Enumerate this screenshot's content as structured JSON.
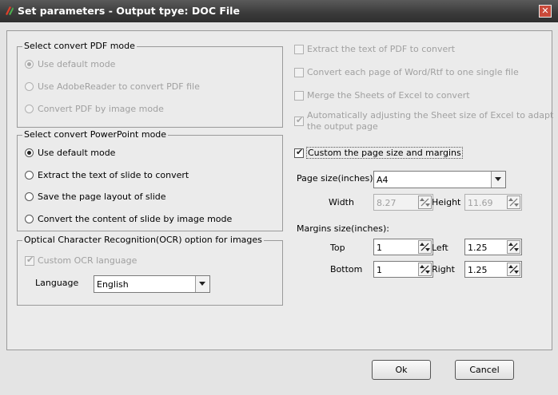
{
  "window": {
    "title": "Set parameters - Output tpye: DOC File",
    "close_icon": "close-icon"
  },
  "pdf_mode": {
    "title": "Select convert PDF mode",
    "options": [
      "Use default mode",
      "Use AdobeReader to convert PDF file",
      "Convert PDF by image mode"
    ]
  },
  "ppt_mode": {
    "title": "Select convert PowerPoint mode",
    "options": [
      "Use default mode",
      "Extract the text of slide to convert",
      "Save the page layout of slide",
      "Convert the content of slide by image mode"
    ]
  },
  "ocr": {
    "title": "Optical Character Recognition(OCR) option for images",
    "custom_label": "Custom OCR language",
    "language_label": "Language",
    "language_value": "English"
  },
  "right": {
    "extract_text": "Extract the text of PDF to convert",
    "convert_each_page": "Convert each page of Word/Rtf to one single file",
    "merge_sheets": "Merge the Sheets of Excel to convert",
    "auto_adjust_line1": "Automatically adjusting the Sheet size of Excel to adapt",
    "auto_adjust_line2": "the output page",
    "custom_page": "Custom the page size and margins",
    "page_size_label": "Page size(inches):",
    "page_size_value": "A4",
    "width_label": "Width",
    "width_value": "8.27",
    "height_label": "Height",
    "height_value": "11.69",
    "margins_label": "Margins size(inches):",
    "top_label": "Top",
    "top_value": "1",
    "left_label": "Left",
    "left_value": "1.25",
    "bottom_label": "Bottom",
    "bottom_value": "1",
    "right_label": "Right",
    "right_value": "1.25"
  },
  "buttons": {
    "ok": "Ok",
    "cancel": "Cancel"
  }
}
